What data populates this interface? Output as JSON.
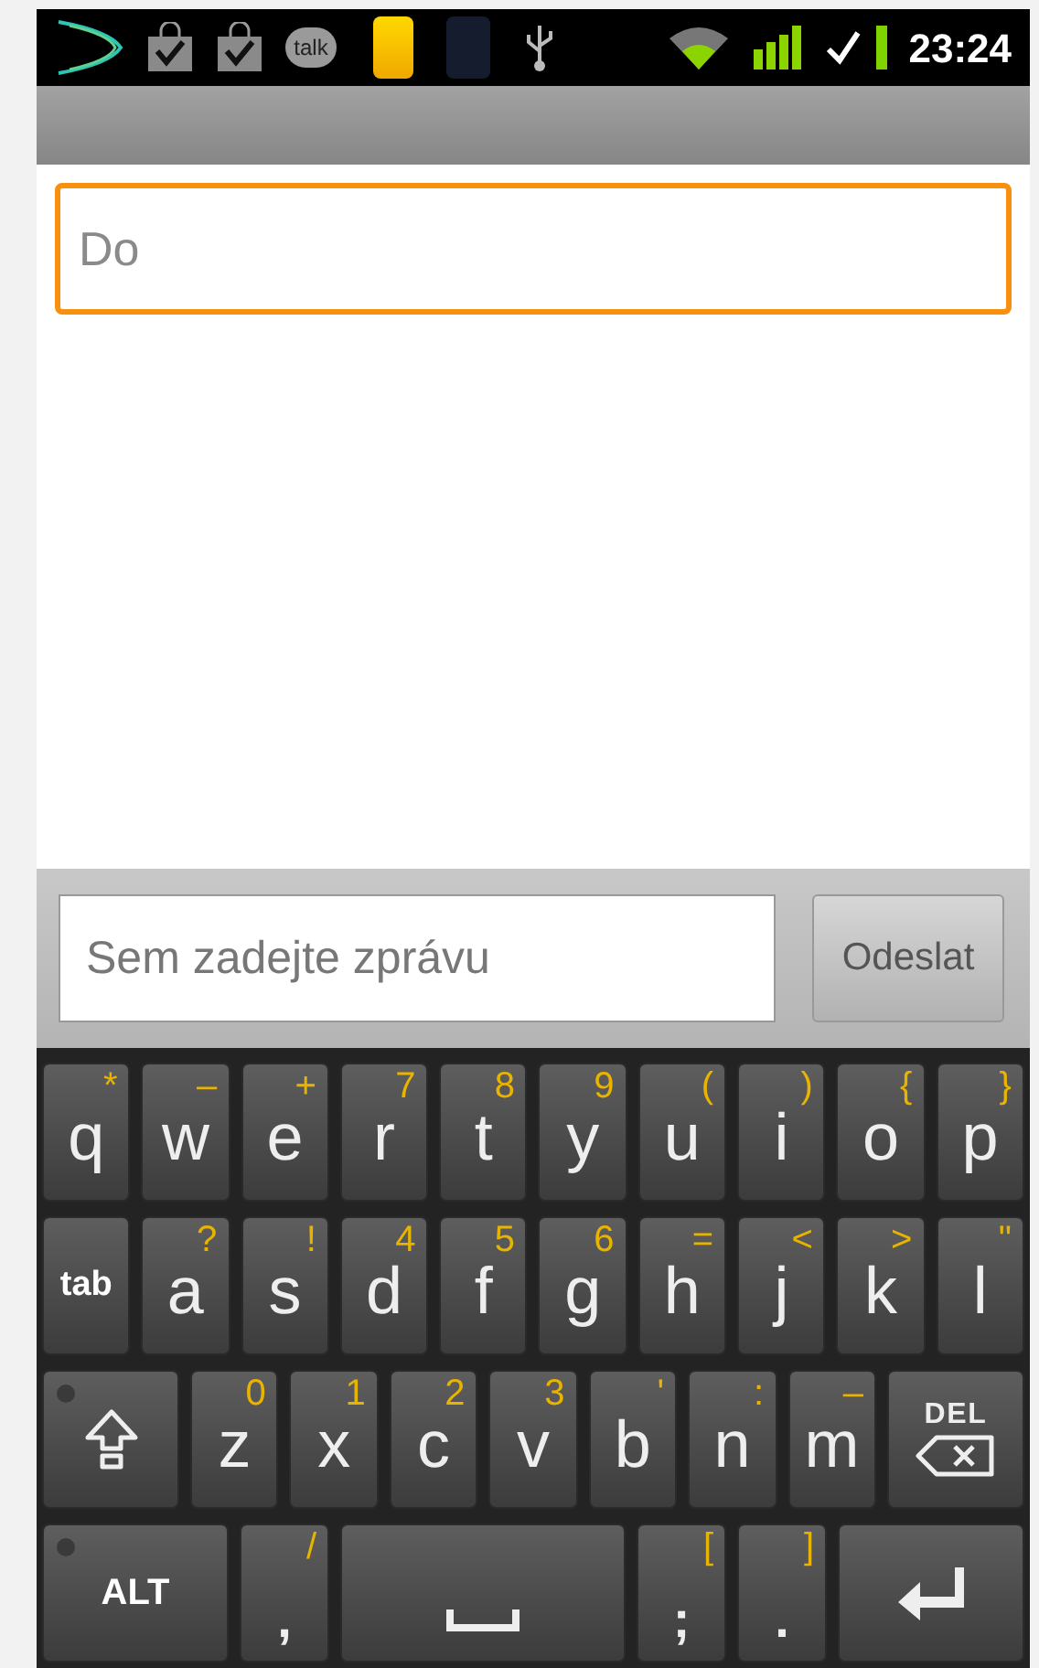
{
  "status_bar": {
    "talk_label": "talk",
    "time": "23:24"
  },
  "recipient": {
    "placeholder": "Do",
    "focused": true
  },
  "compose": {
    "placeholder": "Sem zadejte zprávu",
    "send_label": "Odeslat"
  },
  "keyboard": {
    "rows": [
      {
        "keys": [
          {
            "kind": "letter",
            "main": "q",
            "alt": "*"
          },
          {
            "kind": "letter",
            "main": "w",
            "alt": "–"
          },
          {
            "kind": "letter",
            "main": "e",
            "alt": "+"
          },
          {
            "kind": "letter",
            "main": "r",
            "alt": "7"
          },
          {
            "kind": "letter",
            "main": "t",
            "alt": "8"
          },
          {
            "kind": "letter",
            "main": "y",
            "alt": "9"
          },
          {
            "kind": "letter",
            "main": "u",
            "alt": "("
          },
          {
            "kind": "letter",
            "main": "i",
            "alt": ")"
          },
          {
            "kind": "letter",
            "main": "o",
            "alt": "{"
          },
          {
            "kind": "letter",
            "main": "p",
            "alt": "}"
          }
        ]
      },
      {
        "keys": [
          {
            "kind": "label",
            "main": "tab"
          },
          {
            "kind": "letter",
            "main": "a",
            "alt": "?"
          },
          {
            "kind": "letter",
            "main": "s",
            "alt": "!"
          },
          {
            "kind": "letter",
            "main": "d",
            "alt": "4"
          },
          {
            "kind": "letter",
            "main": "f",
            "alt": "5"
          },
          {
            "kind": "letter",
            "main": "g",
            "alt": "6"
          },
          {
            "kind": "letter",
            "main": "h",
            "alt": "="
          },
          {
            "kind": "letter",
            "main": "j",
            "alt": "<"
          },
          {
            "kind": "letter",
            "main": "k",
            "alt": ">"
          },
          {
            "kind": "letter",
            "main": "l",
            "alt": "\""
          }
        ]
      },
      {
        "keys": [
          {
            "kind": "shift",
            "on": false
          },
          {
            "kind": "letter",
            "main": "z",
            "alt": "0"
          },
          {
            "kind": "letter",
            "main": "x",
            "alt": "1"
          },
          {
            "kind": "letter",
            "main": "c",
            "alt": "2"
          },
          {
            "kind": "letter",
            "main": "v",
            "alt": "3"
          },
          {
            "kind": "letter",
            "main": "b",
            "alt": "'"
          },
          {
            "kind": "letter",
            "main": "n",
            "alt": ":"
          },
          {
            "kind": "letter",
            "main": "m",
            "alt": "–"
          },
          {
            "kind": "del",
            "main": "DEL"
          }
        ]
      },
      {
        "keys": [
          {
            "kind": "alt",
            "main": "ALT",
            "on": false
          },
          {
            "kind": "punct",
            "main": ",",
            "alt": "/"
          },
          {
            "kind": "space"
          },
          {
            "kind": "punct",
            "main": ";",
            "alt": "["
          },
          {
            "kind": "punct",
            "main": ".",
            "alt": "]"
          },
          {
            "kind": "enter"
          }
        ]
      }
    ]
  }
}
